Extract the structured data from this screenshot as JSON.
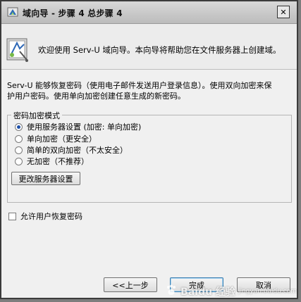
{
  "window": {
    "title": "域向导 - 步骤 4 总步骤 4",
    "close_glyph": "✕"
  },
  "banner": {
    "text": "欢迎使用 Serv-U 域向导。本向导将帮助您在文件服务器上创建域。"
  },
  "description": {
    "line1": "Serv-U 能够恢复密码（使用电子邮件发送用户登录信息）。使用双向加密来保",
    "line2": "护用户密码。使用单向加密创建任意生成的新密码。"
  },
  "encryption_group": {
    "legend": "密码加密模式",
    "options": [
      {
        "label": "使用服务器设置 (加密: 单向加密)",
        "selected": true
      },
      {
        "label": "单向加密（更安全）",
        "selected": false
      },
      {
        "label": "简单的双向加密（不太安全）",
        "selected": false
      },
      {
        "label": "无加密（不推荐）",
        "selected": false
      }
    ],
    "change_settings_label": "更改服务器设置"
  },
  "allow_recovery": {
    "label": "允许用户恢复密码",
    "checked": false
  },
  "footer": {
    "back_label": "<<上一步",
    "finish_label": "完成",
    "cancel_label": "取消"
  },
  "watermark": {
    "text": "Baidu 经验",
    "url_text": "jingyan.baidu.com"
  },
  "colors": {
    "radio_selected": "#1d4fa8",
    "window_bg": "#f0f0f0",
    "focus_border": "#3c7fb1"
  }
}
